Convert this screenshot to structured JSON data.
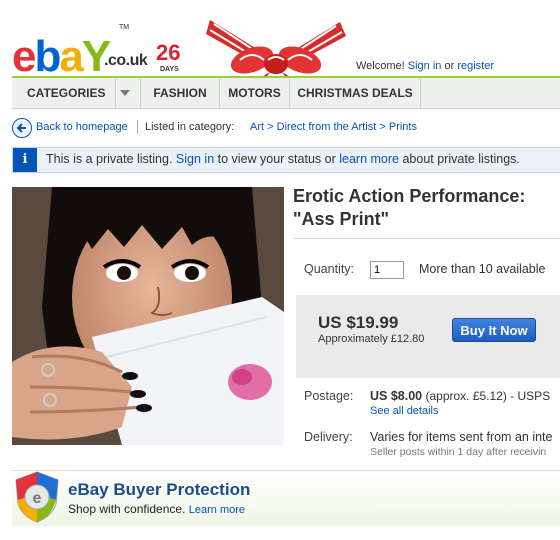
{
  "header": {
    "logo": {
      "e": "e",
      "b": "b",
      "a": "a",
      "y": "Y"
    },
    "domain": ".co.uk",
    "trademark": "TM",
    "days_number": "26",
    "days_label": "DAYS",
    "welcome": "Welcome!",
    "sign_in": "Sign in",
    "or": "or",
    "register": "register"
  },
  "nav": {
    "items": [
      "CATEGORIES",
      "FASHION",
      "MOTORS",
      "CHRISTMAS DEALS"
    ]
  },
  "breadcrumb": {
    "back": "Back to homepage",
    "listed_in": "Listed in category:",
    "cat1": "Art",
    "sep": ">",
    "cat2": "Direct from the Artist",
    "cat3": "Prints"
  },
  "info_bar": {
    "icon": "i",
    "text1": "This is a private listing.",
    "sign_in": "Sign in",
    "text2": "to view your status or",
    "learn_more": "learn more",
    "text3": "about private listings."
  },
  "listing": {
    "title_line1": "Erotic Action Performance:",
    "title_line2": "\"Ass Print\"",
    "quantity_label": "Quantity:",
    "quantity_value": "1",
    "availability": "More than 10 available",
    "price": "US $19.99",
    "approx": "Approximately £12.80",
    "buy_now": "Buy It Now",
    "postage_label": "Postage:",
    "postage_amount": "US $8.00",
    "postage_rest": "(approx. £5.12) - USPS",
    "see_all": "See all details",
    "delivery_label": "Delivery:",
    "delivery_text": "Varies for items sent from an inte",
    "delivery_sub": "Seller posts within 1 day after receivin"
  },
  "protection": {
    "title": "eBay Buyer Protection",
    "subtitle": "Shop with confidence.",
    "learn_more": "Learn more",
    "badge_letter": "e"
  },
  "colors": {
    "link": "#0654ba",
    "nav_accent": "#9fcb3c",
    "days_red": "#d9242b",
    "buy_button": "#1d5cc2"
  }
}
